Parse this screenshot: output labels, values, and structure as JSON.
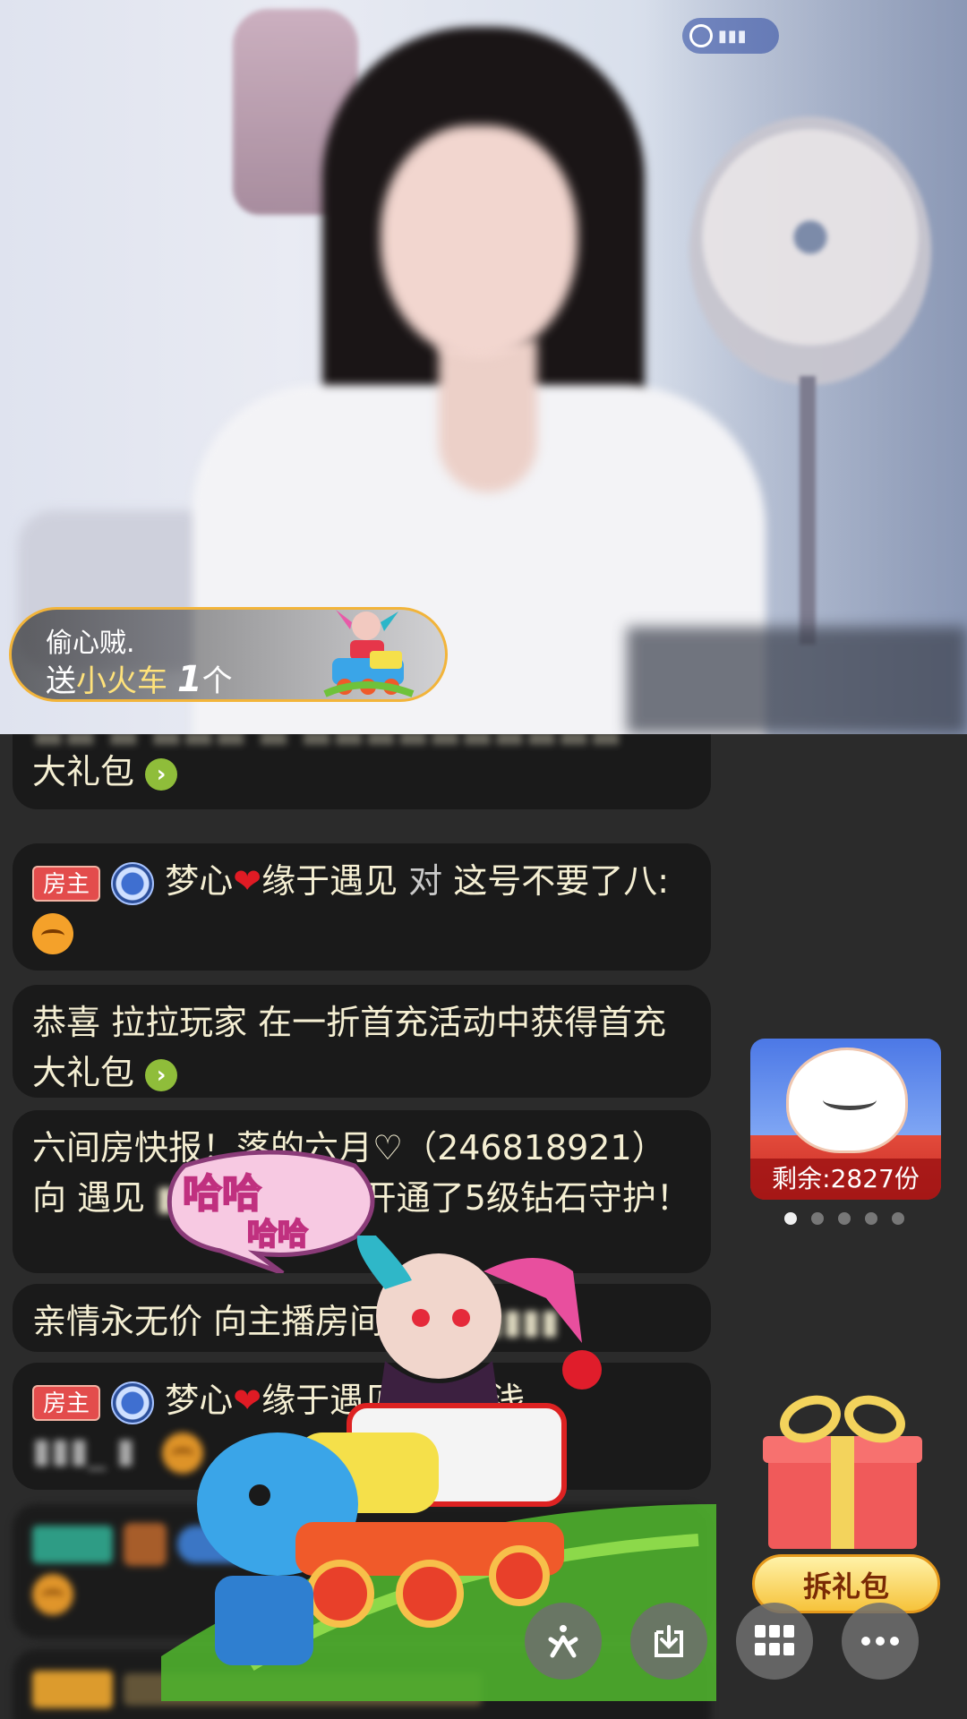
{
  "video": {
    "gift_toast": {
      "sender": "偷心贼.",
      "send_word": "送",
      "gift_name": "小火车",
      "gift_count": "1",
      "unit": "个"
    }
  },
  "chat": {
    "messages": [
      {
        "type": "system",
        "text": "大礼包"
      },
      {
        "type": "user",
        "tag": "房主",
        "user": "梦心",
        "user_suffix": "缘于遇见",
        "verb": "对",
        "text": "这号不要了八:"
      },
      {
        "type": "system",
        "text": "恭喜 拉拉玩家 在一折首充活动中获得首充大礼包"
      },
      {
        "type": "broadcast",
        "text_a": " 六间房快报！落的六月♡（246818921）向 遇见",
        "text_b": "1450）开通了5级钻石守护！"
      },
      {
        "type": "system",
        "text": "亲情永无价 向主播房间赠"
      },
      {
        "type": "user",
        "tag": "房主",
        "user": "梦心",
        "user_suffix": "缘于遇见",
        "verb": "",
        "text": "醒浅"
      }
    ]
  },
  "bubble": {
    "line1": "哈哈",
    "line2": "哈哈"
  },
  "promo": {
    "remain_label": "剩余:",
    "remain_count": "2827",
    "remain_unit": "份",
    "active_dot": 0,
    "dot_count": 5
  },
  "gift": {
    "open_label": "拆礼包"
  },
  "toolbar": {
    "items": [
      "six-logo-icon",
      "download-icon",
      "grid-icon",
      "more-icon"
    ]
  }
}
